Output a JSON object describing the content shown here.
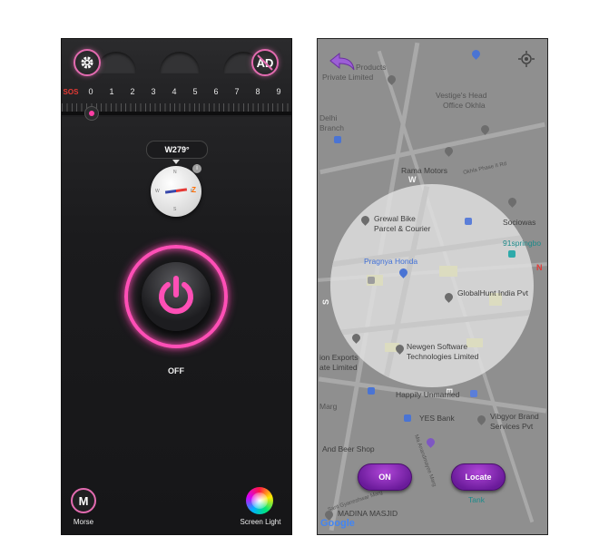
{
  "left_screen": {
    "settings_icon": "gear-icon",
    "ad_button_label": "AD",
    "scale": {
      "sos_label": "SOS",
      "numbers": [
        "0",
        "1",
        "2",
        "3",
        "4",
        "5",
        "6",
        "7",
        "8",
        "9"
      ]
    },
    "heading_value": "W279°",
    "compass": {
      "north": "N",
      "south": "S",
      "east": "E",
      "west": "W",
      "z_label": "Z",
      "info": "i"
    },
    "power_state_label": "OFF",
    "morse_button_label": "M",
    "morse_label": "Morse",
    "screen_light_label": "Screen Light",
    "accent_color": "#ff4fb6"
  },
  "right_screen": {
    "map_labels": {
      "products": "Products",
      "private_limited": "Private Limited",
      "vestiges_head": "Vestige's Head",
      "office_okhla": "Office Okhla",
      "delhi": "Delhi",
      "branch": "Branch",
      "rama_motors": "Rama Motors",
      "okhla_phase": "Okhla Phase II Rd",
      "grewal_bike": "Grewal Bike",
      "parcel_courier": "Parcel & Courier",
      "sociowas": "Sociowas",
      "springboard": "91springbo",
      "pragnya_honda": "Pragnya Honda",
      "globalhunt": "GlobalHunt India Pvt",
      "exports": "ion Exports",
      "ate_limited": "ate Limited",
      "newgen": "Newgen Software",
      "technologies": "Technologies Limited",
      "happily": "Happily Unmarried",
      "marg": "Marg",
      "yes_bank": "YES Bank",
      "vibgyor": "Vibgyor Brand",
      "services": "Services Pvt",
      "and_beer": "And Beer Shop",
      "ma_anandmayee": "Ma Anandmayee Marg",
      "sant_gyaneshwar": "Sant Gyaneshwar Marg",
      "madina_masjid": "MADINA MASJID",
      "tank": "Tank",
      "google": "Google"
    },
    "directions": {
      "west": "W",
      "south": "S",
      "east": "E",
      "north": "N"
    },
    "on_button_label": "ON",
    "locate_button_label": "Locate",
    "back_icon": "back-arrow-icon",
    "locate_icon": "my-location-icon",
    "overlay_color": "#e1e1e1",
    "button_color": "#8e24aa"
  }
}
